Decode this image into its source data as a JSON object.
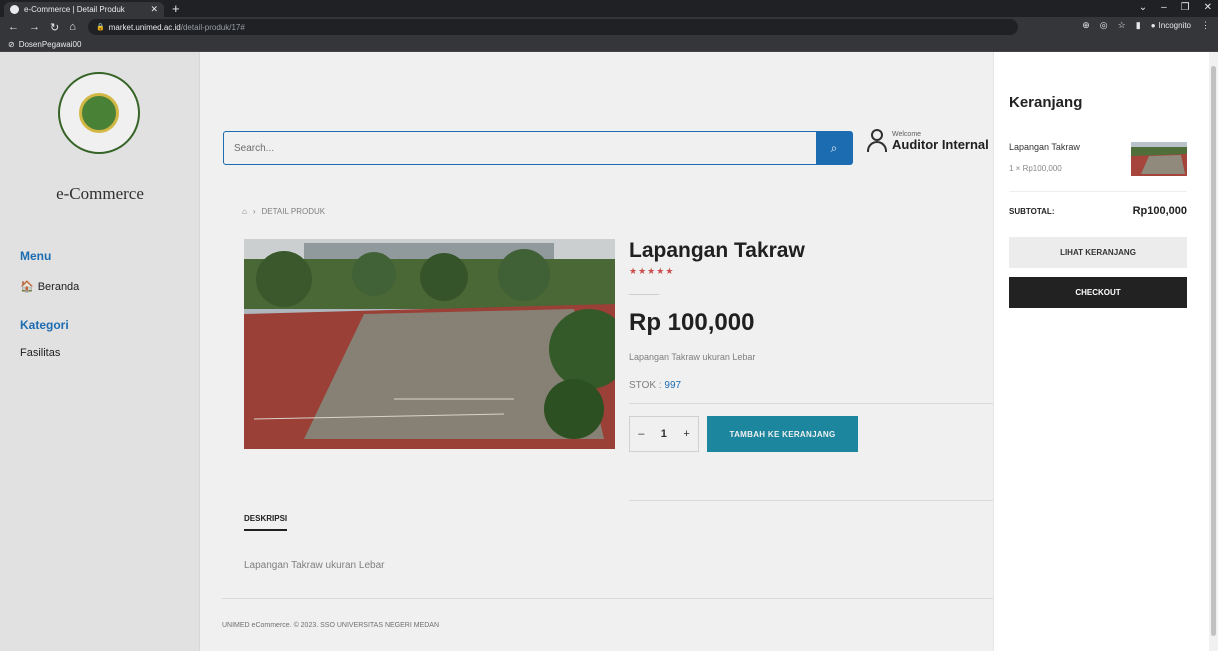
{
  "browser": {
    "tab_title": "e-Commerce | Detail Produk",
    "url_host": "market.unimed.ac.id",
    "url_path": "/detail-produk/17#",
    "incognito_label": "Incognito",
    "bookmark": "DosenPegawai00"
  },
  "sidebar": {
    "brand": "e-Commerce",
    "menu_heading": "Menu",
    "menu_items": [
      {
        "label": "Beranda",
        "icon": "home-icon"
      }
    ],
    "category_heading": "Kategori",
    "category_items": [
      {
        "label": "Fasilitas"
      }
    ]
  },
  "header": {
    "search_placeholder": "Search...",
    "welcome": "Welcome",
    "user_name": "Auditor Internal"
  },
  "breadcrumb": {
    "current": "DETAIL PRODUK"
  },
  "product": {
    "title": "Lapangan Takraw",
    "rating": 5,
    "price": "Rp 100,000",
    "short_description": "Lapangan Takraw ukuran Lebar",
    "stock_label": "STOK :",
    "stock_value": "997",
    "quantity": "1",
    "add_to_cart": "TAMBAH KE KERANJANG"
  },
  "tabs": {
    "description_tab": "DESKRIPSI",
    "description_text": "Lapangan Takraw ukuran Lebar"
  },
  "footer": {
    "text": "UNIMED eCommerce. © 2023. SSO UNIVERSITAS NEGERI MEDAN"
  },
  "cart": {
    "title": "Keranjang",
    "items": [
      {
        "name": "Lapangan Takraw",
        "qty_price": "1 × Rp100,000"
      }
    ],
    "subtotal_label": "SUBTOTAL:",
    "subtotal_value": "Rp100,000",
    "view_cart": "LIHAT KERANJANG",
    "checkout": "CHECKOUT"
  },
  "colors": {
    "accent": "#1e73be",
    "cart_button": "#1e8fa8",
    "stars": "#d9534f"
  }
}
